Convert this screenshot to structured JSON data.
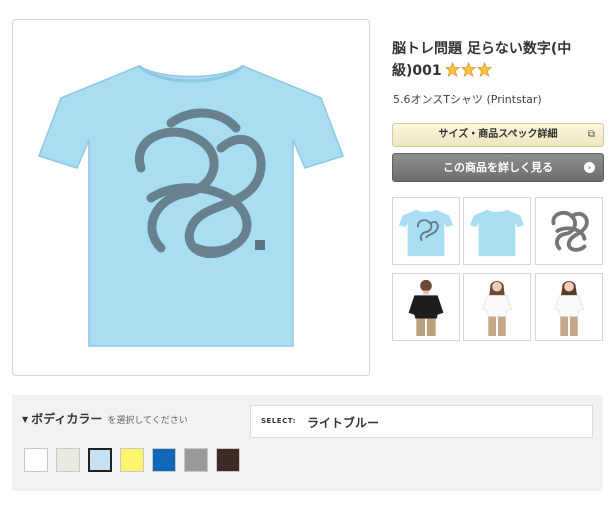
{
  "product": {
    "title": "脳トレ問題 足らない数字(中級)001",
    "subtitle": "5.6オンスTシャツ (Printstar)",
    "rating_icons": [
      "star-icon",
      "star-icon",
      "star-icon"
    ]
  },
  "buttons": {
    "spec_label": "サイズ・商品スペック詳細",
    "detail_label": "この商品を詳しく見る"
  },
  "body_color": {
    "heading": "ボディカラー",
    "hint": "を選択してください",
    "select_label": "SELECT:",
    "selected_value": "ライトブルー",
    "swatches": [
      {
        "color": "#ffffff"
      },
      {
        "color": "#e9e9e2"
      },
      {
        "color": "#c6e3f3",
        "selected": true
      },
      {
        "color": "#fff56c"
      },
      {
        "color": "#1268b8"
      },
      {
        "color": "#9a9a9a"
      },
      {
        "color": "#3d2a22"
      }
    ]
  },
  "colors": {
    "tshirt": "#a9ddf2",
    "print": "#4d5b66",
    "accent_button_top": "#fbf6df",
    "dark_button": "#7d7d7d"
  }
}
